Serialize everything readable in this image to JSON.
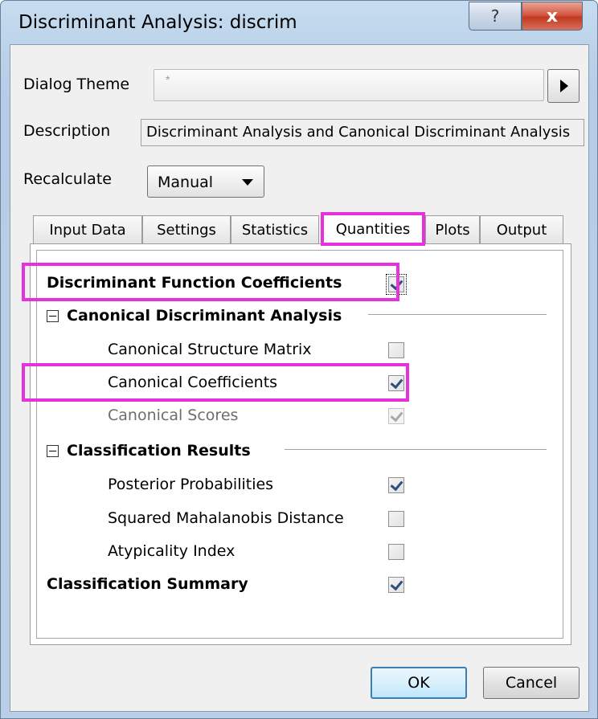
{
  "window": {
    "title": "Discriminant Analysis: discrim",
    "help_label": "?",
    "close_label": "x"
  },
  "dialog_theme": {
    "label": "Dialog Theme",
    "value": "*"
  },
  "description": {
    "label": "Description",
    "value": "Discriminant Analysis and Canonical Discriminant Analysis"
  },
  "recalculate": {
    "label": "Recalculate",
    "selected": "Manual"
  },
  "tabs": [
    {
      "label": "Input Data",
      "active": false
    },
    {
      "label": "Settings",
      "active": false
    },
    {
      "label": "Statistics",
      "active": false
    },
    {
      "label": "Quantities",
      "active": true
    },
    {
      "label": "Plots",
      "active": false
    },
    {
      "label": "Output",
      "active": false
    }
  ],
  "quantities": {
    "discriminant_function_coefficients": {
      "label": "Discriminant Function Coefficients",
      "checked": true
    },
    "canonical_section": {
      "label": "Canonical Discriminant Analysis",
      "items": [
        {
          "label": "Canonical Structure Matrix",
          "checked": false,
          "enabled": true
        },
        {
          "label": "Canonical Coefficients",
          "checked": true,
          "enabled": true
        },
        {
          "label": "Canonical Scores",
          "checked": true,
          "enabled": false
        }
      ]
    },
    "classification_section": {
      "label": "Classification Results",
      "items": [
        {
          "label": "Posterior Probabilities",
          "checked": true,
          "enabled": true
        },
        {
          "label": "Squared Mahalanobis Distance",
          "checked": false,
          "enabled": true
        },
        {
          "label": "Atypicality Index",
          "checked": false,
          "enabled": true
        }
      ]
    },
    "classification_summary": {
      "label": "Classification Summary",
      "checked": true
    }
  },
  "buttons": {
    "ok": "OK",
    "cancel": "Cancel"
  },
  "colors": {
    "highlight": "#e532dc",
    "check": "#2e4d7c"
  }
}
